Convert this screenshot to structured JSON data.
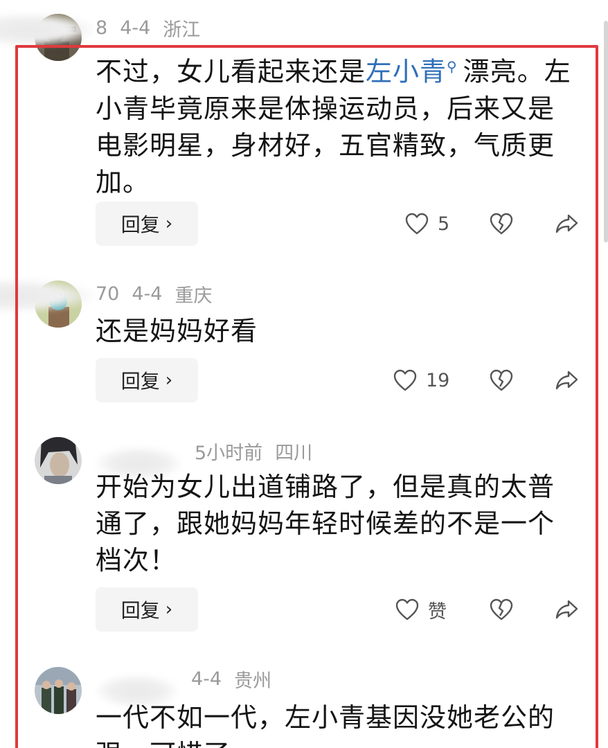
{
  "comments": [
    {
      "meta": {
        "name_tail": "8",
        "date": "4-4",
        "location": "浙江"
      },
      "text_before": "不过，女儿看起来还是",
      "mention": "左小青",
      "text_after": "漂亮。左小青毕竟原来是体操运动员，后来又是电影明星，身材好，五官精致，气质更加。",
      "reply_label": "回复",
      "like_count": "5"
    },
    {
      "meta": {
        "name_tail": "70",
        "date": "4-4",
        "location": "重庆"
      },
      "text": "还是妈妈好看",
      "reply_label": "回复",
      "like_count": "19"
    },
    {
      "meta": {
        "name_tail": "",
        "date": "5小时前",
        "location": "四川"
      },
      "text": "开始为女儿出道铺路了，但是真的太普通了，跟她妈妈年轻时候差的不是一个档次！",
      "reply_label": "回复",
      "like_count": "赞"
    },
    {
      "meta": {
        "name_tail": "",
        "date": "4-4",
        "location": "贵州"
      },
      "text": "一代不如一代，左小青基因没她老公的强，可惜了。"
    }
  ],
  "icons": {
    "like": "heart-outline-icon",
    "dislike": "broken-heart-icon",
    "share": "share-arrow-icon",
    "mention": "search-icon"
  },
  "colors": {
    "highlight_border": "#e0393e",
    "mention": "#2f6fb8",
    "meta_text": "#9a9a9a",
    "reply_bg": "#f4f4f4"
  }
}
